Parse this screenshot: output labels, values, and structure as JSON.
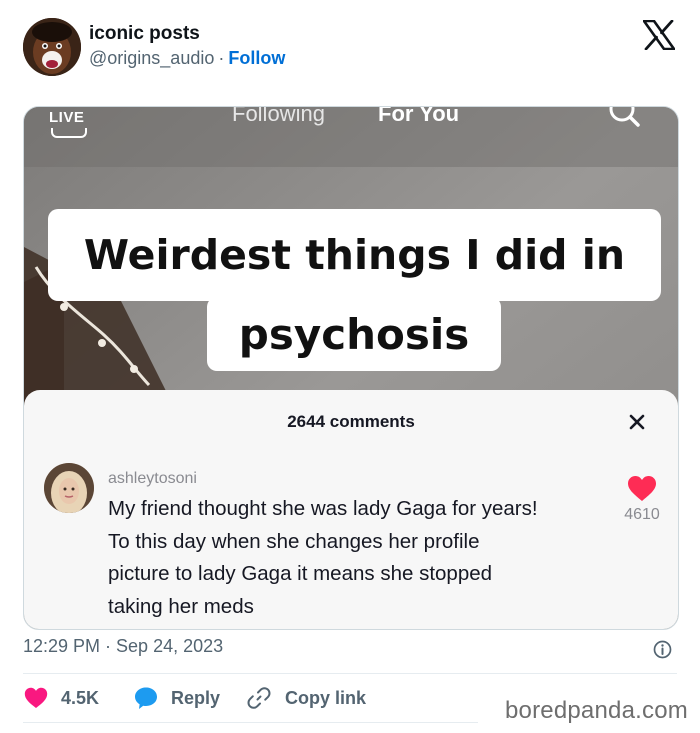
{
  "tweet": {
    "author_name": "iconic posts",
    "author_handle": "@origins_audio",
    "separator": "·",
    "follow_label": "Follow",
    "timestamp": "12:29 PM · Sep 24, 2023"
  },
  "media": {
    "live_label": "LIVE",
    "feed_tabs": [
      "Following",
      "For You"
    ],
    "active_tab": "For You",
    "caption_lines": [
      "Weirdest things I did in",
      "psychosis"
    ],
    "comments_count": "2644 comments",
    "comment": {
      "username": "ashleytosoni",
      "lines": [
        "My friend thought she was lady Gaga for years!",
        "To this day when she changes her profile",
        "picture to lady Gaga it means she stopped",
        "taking her meds"
      ],
      "likes": "4610"
    }
  },
  "actions": {
    "like_count": "4.5K",
    "reply_label": "Reply",
    "copy_label": "Copy link"
  },
  "watermark": "boredpanda.com",
  "icons": [
    "x-logo-icon",
    "search-icon",
    "close-icon",
    "heart-icon",
    "info-icon",
    "reply-bubble-icon",
    "link-icon"
  ],
  "colors": {
    "follow_blue": "#006fd6",
    "like_red": "#f91880",
    "reply_blue": "#1d9bf0",
    "tiktok_heart": "#fe2c55"
  }
}
